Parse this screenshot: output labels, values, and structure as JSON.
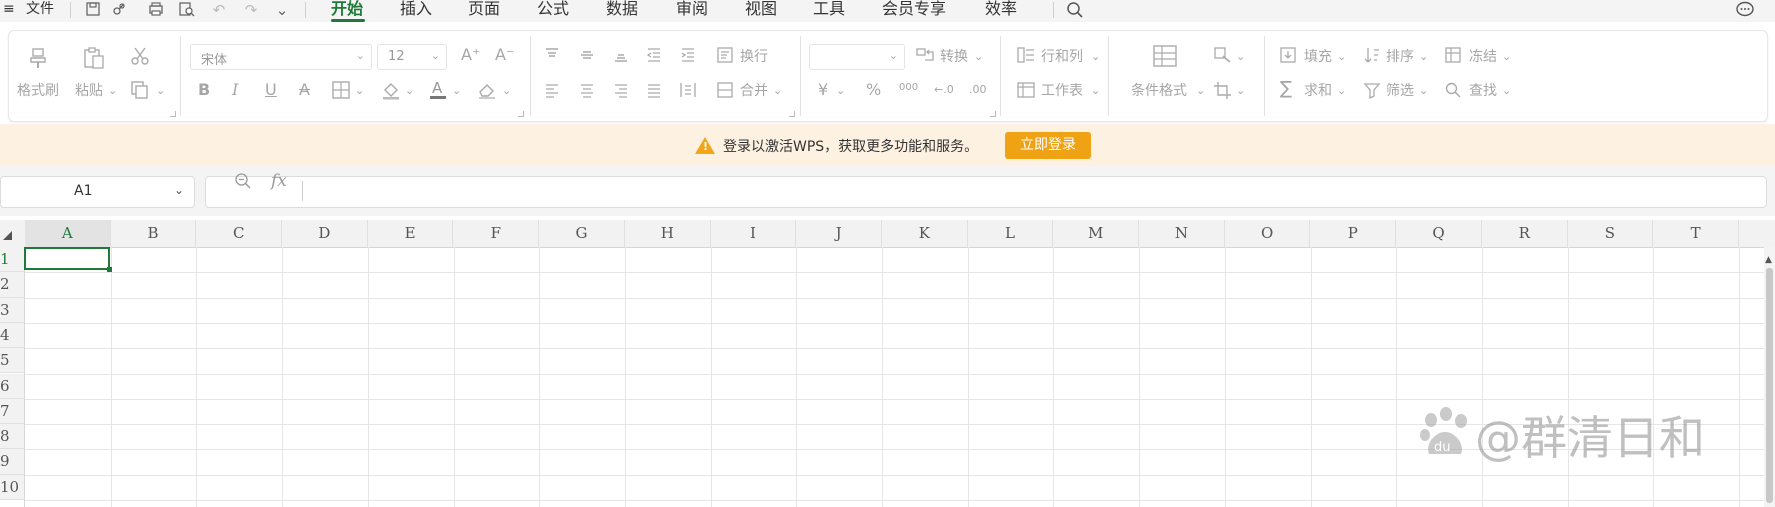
{
  "menubar": {
    "hamburger": "≡",
    "file": "文件",
    "tabs": [
      "开始",
      "插入",
      "页面",
      "公式",
      "数据",
      "审阅",
      "视图",
      "工具",
      "会员专享",
      "效率"
    ],
    "active_tab": "开始",
    "icons": [
      "save-icon",
      "link-icon",
      "print-icon",
      "print-preview-icon",
      "undo-icon",
      "redo-icon",
      "more-chevron-icon",
      "search-icon",
      "chat-bubble-icon"
    ]
  },
  "ribbon": {
    "format_painter": "格式刷",
    "paste": "粘贴",
    "font_name": "宋体",
    "font_size": "12",
    "wrap": "换行",
    "merge": "合并",
    "convert": "转换",
    "rows_cols": "行和列",
    "worksheet": "工作表",
    "cond_format": "条件格式",
    "fill": "填充",
    "sort": "排序",
    "freeze": "冻结",
    "sum": "求和",
    "filter": "筛选",
    "find": "查找",
    "currency": "¥",
    "percent": "%",
    "thousands": "000",
    "inc_dec": "←.0",
    "dec_dec": ".00",
    "bold": "B",
    "italic": "I",
    "underline": "U",
    "strike": "A",
    "font_grow": "A⁺",
    "font_shrink": "A⁻"
  },
  "notification": {
    "message": "登录以激活WPS，获取更多功能和服务。",
    "button": "立即登录",
    "accent": "#f0a215"
  },
  "formula_bar": {
    "cell_ref": "A1",
    "fx": "fx",
    "content": ""
  },
  "grid": {
    "columns": [
      "A",
      "B",
      "C",
      "D",
      "E",
      "F",
      "G",
      "H",
      "I",
      "J",
      "K",
      "L",
      "M",
      "N",
      "O",
      "P",
      "Q",
      "R",
      "S",
      "T"
    ],
    "rows": [
      "1",
      "2",
      "3",
      "4",
      "5",
      "6",
      "7",
      "8",
      "9",
      "10"
    ],
    "selected_cell": "A1",
    "accent": "#1f7a3a"
  },
  "watermark": {
    "text": "@群清日和",
    "logo_text": "du"
  }
}
